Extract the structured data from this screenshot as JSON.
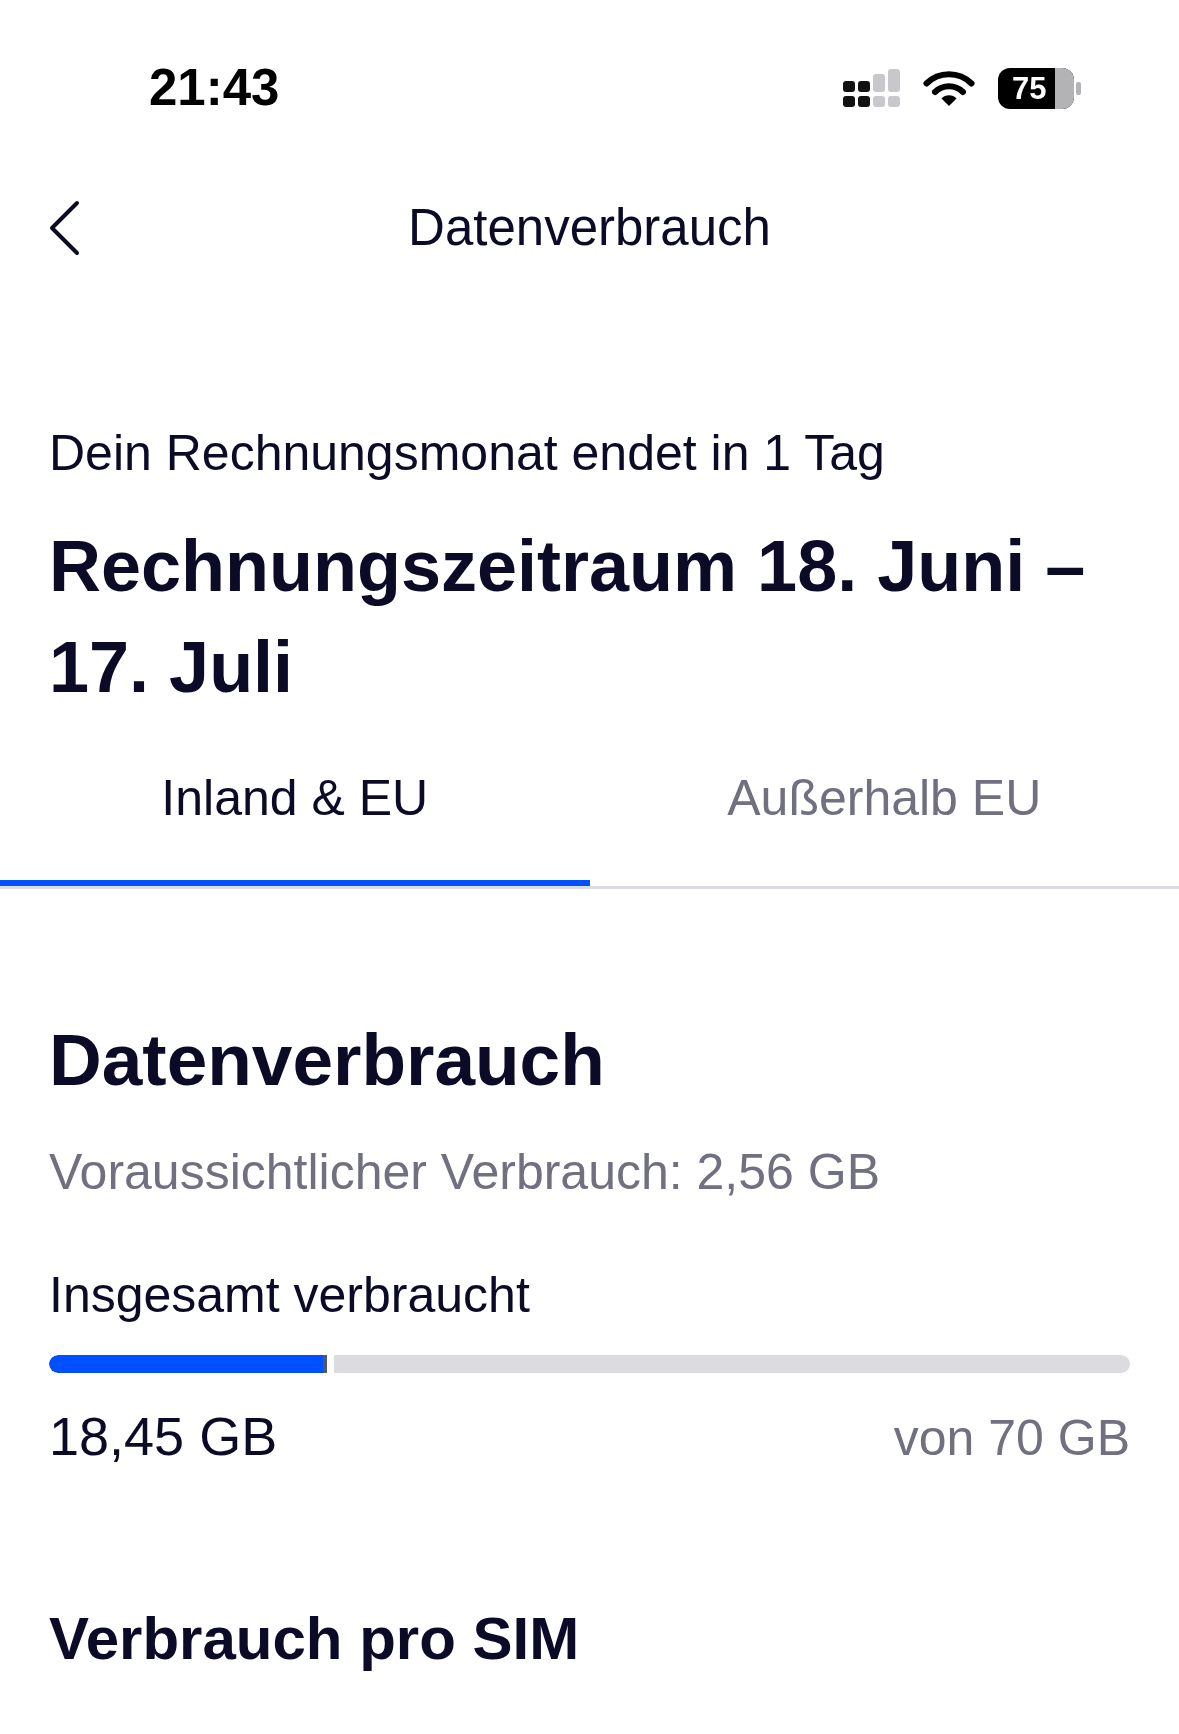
{
  "status_bar": {
    "time": "21:43",
    "battery": "75"
  },
  "nav": {
    "title": "Datenverbrauch"
  },
  "billing": {
    "notice": "Dein Rechnungsmonat endet in 1 Tag",
    "period": "Rechnungszeitraum 18. Juni – 17. Juli"
  },
  "tabs": [
    {
      "label": "Inland & EU",
      "selected": true
    },
    {
      "label": "Außerhalb EU",
      "selected": false
    }
  ],
  "usage": {
    "title": "Datenverbrauch",
    "forecast": "Voraussichtlicher Verbrauch: 2,56 GB",
    "label": "Insgesamt verbraucht",
    "level": 0.264,
    "used": "18,45 GB",
    "total": "von 70 GB"
  },
  "sim_section": {
    "title": "Verbrauch pro SIM"
  }
}
